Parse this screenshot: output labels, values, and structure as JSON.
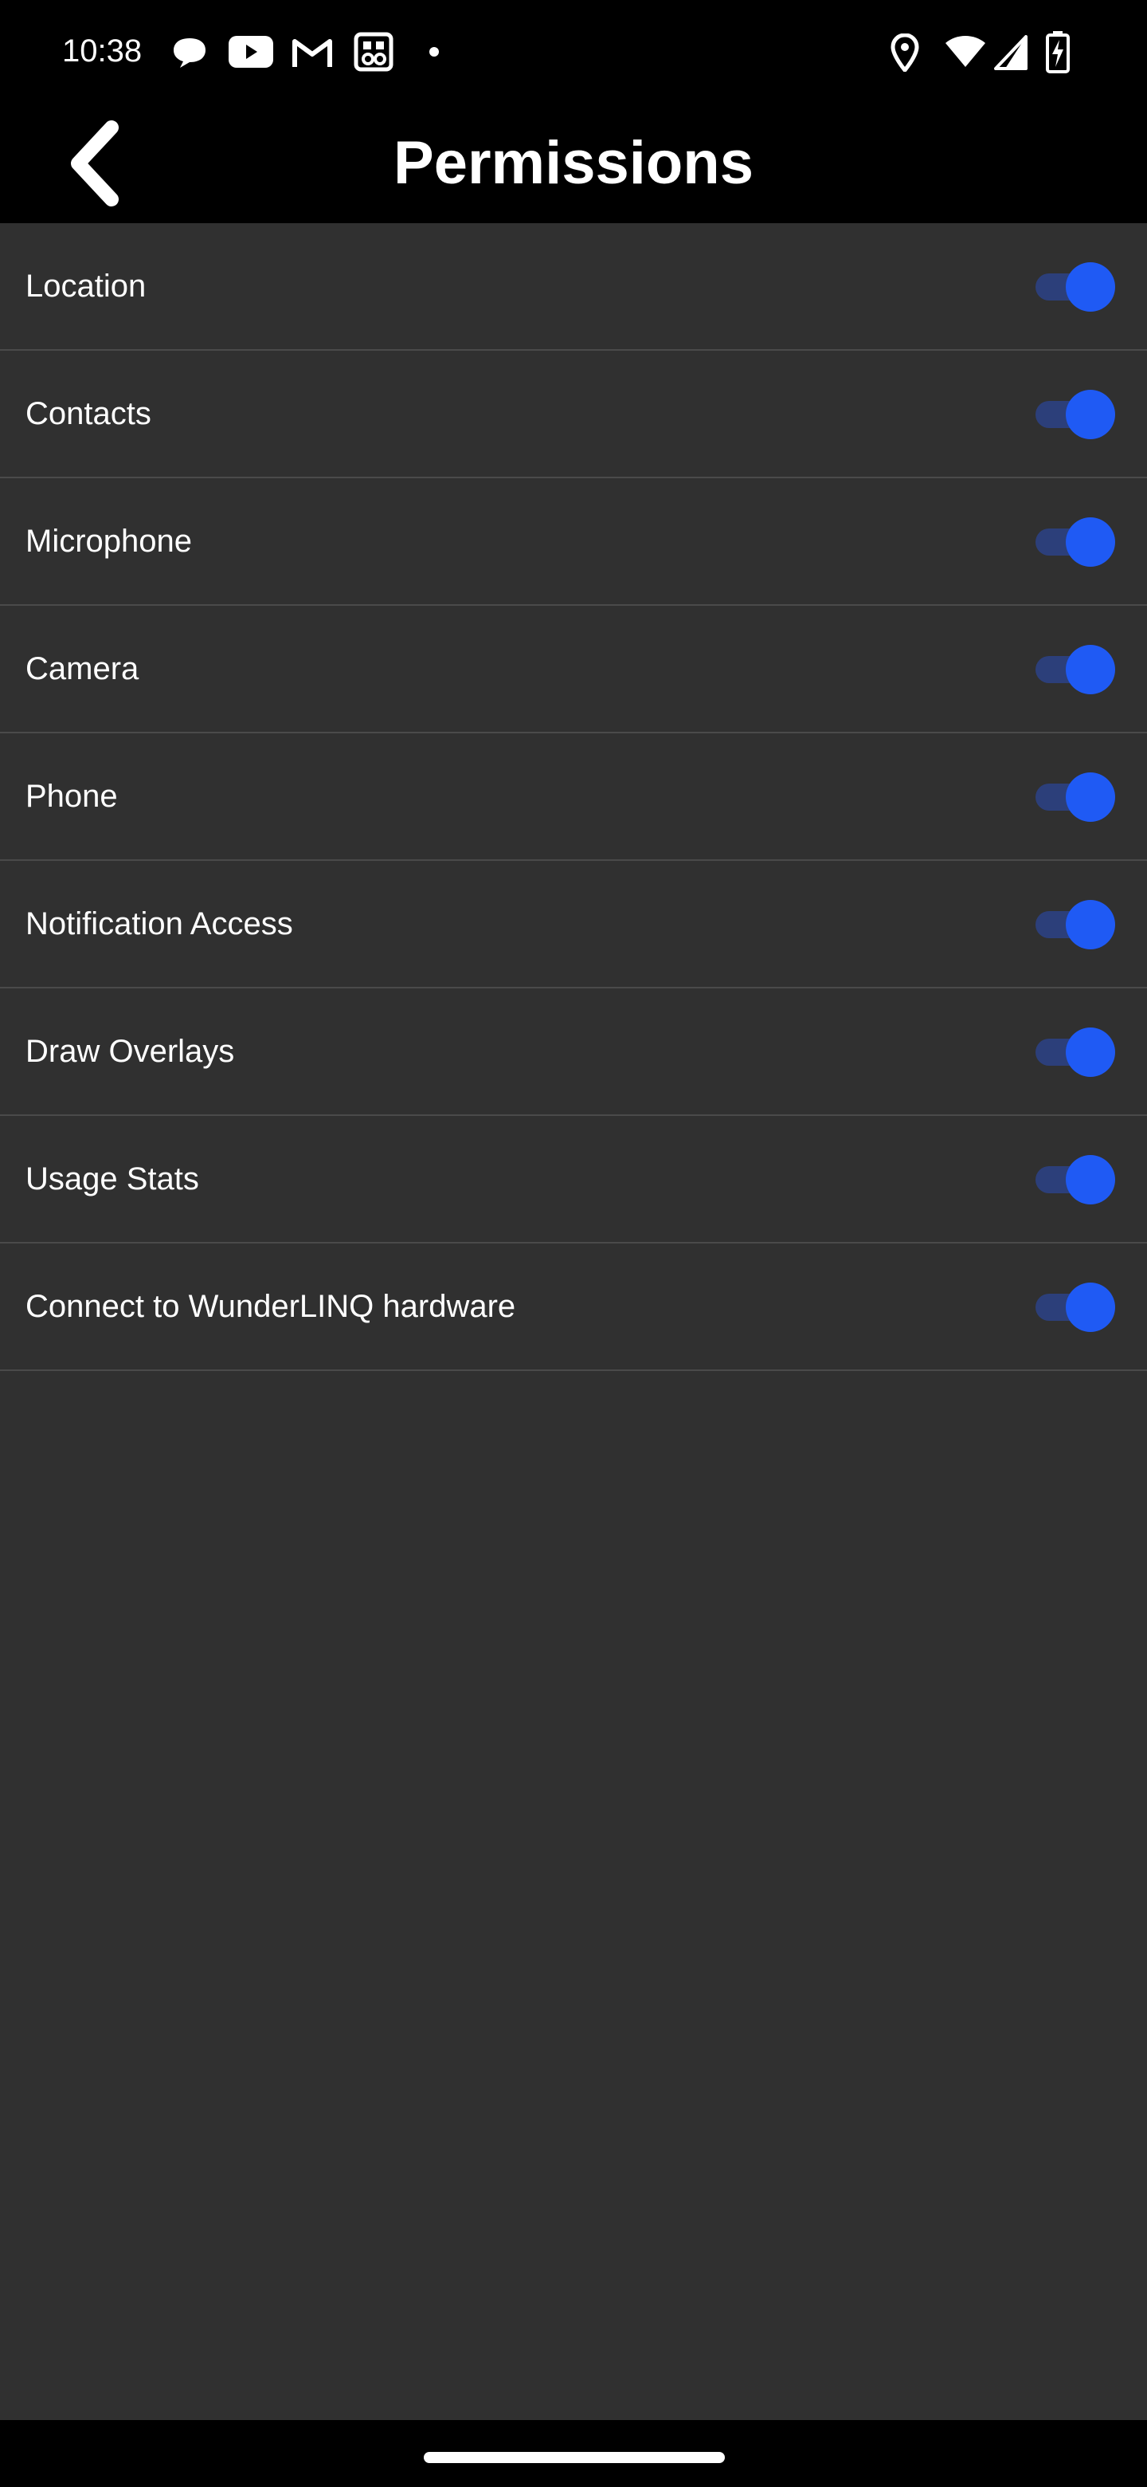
{
  "status_bar": {
    "time": "10:38",
    "notification_icons": [
      "chat-bubble-icon",
      "youtube-icon",
      "gmail-icon",
      "photo-app-icon",
      "dot-icon"
    ],
    "system_icons": [
      "location-icon",
      "wifi-icon",
      "cell-signal-icon",
      "battery-charging-icon"
    ]
  },
  "app_bar": {
    "title": "Permissions",
    "back_icon": "chevron-left-icon"
  },
  "permissions": [
    {
      "label": "Location",
      "enabled": true
    },
    {
      "label": "Contacts",
      "enabled": true
    },
    {
      "label": "Microphone",
      "enabled": true
    },
    {
      "label": "Camera",
      "enabled": true
    },
    {
      "label": "Phone",
      "enabled": true
    },
    {
      "label": "Notification Access",
      "enabled": true
    },
    {
      "label": "Draw Overlays",
      "enabled": true
    },
    {
      "label": "Usage Stats",
      "enabled": true
    },
    {
      "label": "Connect to WunderLINQ hardware",
      "enabled": true
    }
  ],
  "colors": {
    "background": "#303030",
    "app_bar": "#000000",
    "switch_thumb_on": "#1f5af4",
    "switch_track_on": "#2c3f7a",
    "divider": "#4a4a4a",
    "text": "#ffffff"
  }
}
